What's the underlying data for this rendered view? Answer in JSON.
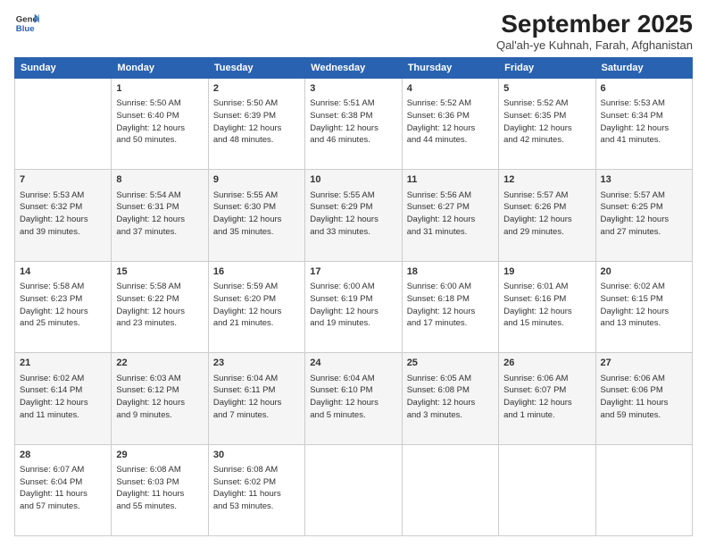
{
  "logo": {
    "line1": "General",
    "line2": "Blue"
  },
  "title": "September 2025",
  "subtitle": "Qal'ah-ye Kuhnah, Farah, Afghanistan",
  "weekdays": [
    "Sunday",
    "Monday",
    "Tuesday",
    "Wednesday",
    "Thursday",
    "Friday",
    "Saturday"
  ],
  "weeks": [
    [
      {
        "day": "",
        "detail": ""
      },
      {
        "day": "1",
        "detail": "Sunrise: 5:50 AM\nSunset: 6:40 PM\nDaylight: 12 hours\nand 50 minutes."
      },
      {
        "day": "2",
        "detail": "Sunrise: 5:50 AM\nSunset: 6:39 PM\nDaylight: 12 hours\nand 48 minutes."
      },
      {
        "day": "3",
        "detail": "Sunrise: 5:51 AM\nSunset: 6:38 PM\nDaylight: 12 hours\nand 46 minutes."
      },
      {
        "day": "4",
        "detail": "Sunrise: 5:52 AM\nSunset: 6:36 PM\nDaylight: 12 hours\nand 44 minutes."
      },
      {
        "day": "5",
        "detail": "Sunrise: 5:52 AM\nSunset: 6:35 PM\nDaylight: 12 hours\nand 42 minutes."
      },
      {
        "day": "6",
        "detail": "Sunrise: 5:53 AM\nSunset: 6:34 PM\nDaylight: 12 hours\nand 41 minutes."
      }
    ],
    [
      {
        "day": "7",
        "detail": "Sunrise: 5:53 AM\nSunset: 6:32 PM\nDaylight: 12 hours\nand 39 minutes."
      },
      {
        "day": "8",
        "detail": "Sunrise: 5:54 AM\nSunset: 6:31 PM\nDaylight: 12 hours\nand 37 minutes."
      },
      {
        "day": "9",
        "detail": "Sunrise: 5:55 AM\nSunset: 6:30 PM\nDaylight: 12 hours\nand 35 minutes."
      },
      {
        "day": "10",
        "detail": "Sunrise: 5:55 AM\nSunset: 6:29 PM\nDaylight: 12 hours\nand 33 minutes."
      },
      {
        "day": "11",
        "detail": "Sunrise: 5:56 AM\nSunset: 6:27 PM\nDaylight: 12 hours\nand 31 minutes."
      },
      {
        "day": "12",
        "detail": "Sunrise: 5:57 AM\nSunset: 6:26 PM\nDaylight: 12 hours\nand 29 minutes."
      },
      {
        "day": "13",
        "detail": "Sunrise: 5:57 AM\nSunset: 6:25 PM\nDaylight: 12 hours\nand 27 minutes."
      }
    ],
    [
      {
        "day": "14",
        "detail": "Sunrise: 5:58 AM\nSunset: 6:23 PM\nDaylight: 12 hours\nand 25 minutes."
      },
      {
        "day": "15",
        "detail": "Sunrise: 5:58 AM\nSunset: 6:22 PM\nDaylight: 12 hours\nand 23 minutes."
      },
      {
        "day": "16",
        "detail": "Sunrise: 5:59 AM\nSunset: 6:20 PM\nDaylight: 12 hours\nand 21 minutes."
      },
      {
        "day": "17",
        "detail": "Sunrise: 6:00 AM\nSunset: 6:19 PM\nDaylight: 12 hours\nand 19 minutes."
      },
      {
        "day": "18",
        "detail": "Sunrise: 6:00 AM\nSunset: 6:18 PM\nDaylight: 12 hours\nand 17 minutes."
      },
      {
        "day": "19",
        "detail": "Sunrise: 6:01 AM\nSunset: 6:16 PM\nDaylight: 12 hours\nand 15 minutes."
      },
      {
        "day": "20",
        "detail": "Sunrise: 6:02 AM\nSunset: 6:15 PM\nDaylight: 12 hours\nand 13 minutes."
      }
    ],
    [
      {
        "day": "21",
        "detail": "Sunrise: 6:02 AM\nSunset: 6:14 PM\nDaylight: 12 hours\nand 11 minutes."
      },
      {
        "day": "22",
        "detail": "Sunrise: 6:03 AM\nSunset: 6:12 PM\nDaylight: 12 hours\nand 9 minutes."
      },
      {
        "day": "23",
        "detail": "Sunrise: 6:04 AM\nSunset: 6:11 PM\nDaylight: 12 hours\nand 7 minutes."
      },
      {
        "day": "24",
        "detail": "Sunrise: 6:04 AM\nSunset: 6:10 PM\nDaylight: 12 hours\nand 5 minutes."
      },
      {
        "day": "25",
        "detail": "Sunrise: 6:05 AM\nSunset: 6:08 PM\nDaylight: 12 hours\nand 3 minutes."
      },
      {
        "day": "26",
        "detail": "Sunrise: 6:06 AM\nSunset: 6:07 PM\nDaylight: 12 hours\nand 1 minute."
      },
      {
        "day": "27",
        "detail": "Sunrise: 6:06 AM\nSunset: 6:06 PM\nDaylight: 11 hours\nand 59 minutes."
      }
    ],
    [
      {
        "day": "28",
        "detail": "Sunrise: 6:07 AM\nSunset: 6:04 PM\nDaylight: 11 hours\nand 57 minutes."
      },
      {
        "day": "29",
        "detail": "Sunrise: 6:08 AM\nSunset: 6:03 PM\nDaylight: 11 hours\nand 55 minutes."
      },
      {
        "day": "30",
        "detail": "Sunrise: 6:08 AM\nSunset: 6:02 PM\nDaylight: 11 hours\nand 53 minutes."
      },
      {
        "day": "",
        "detail": ""
      },
      {
        "day": "",
        "detail": ""
      },
      {
        "day": "",
        "detail": ""
      },
      {
        "day": "",
        "detail": ""
      }
    ]
  ]
}
